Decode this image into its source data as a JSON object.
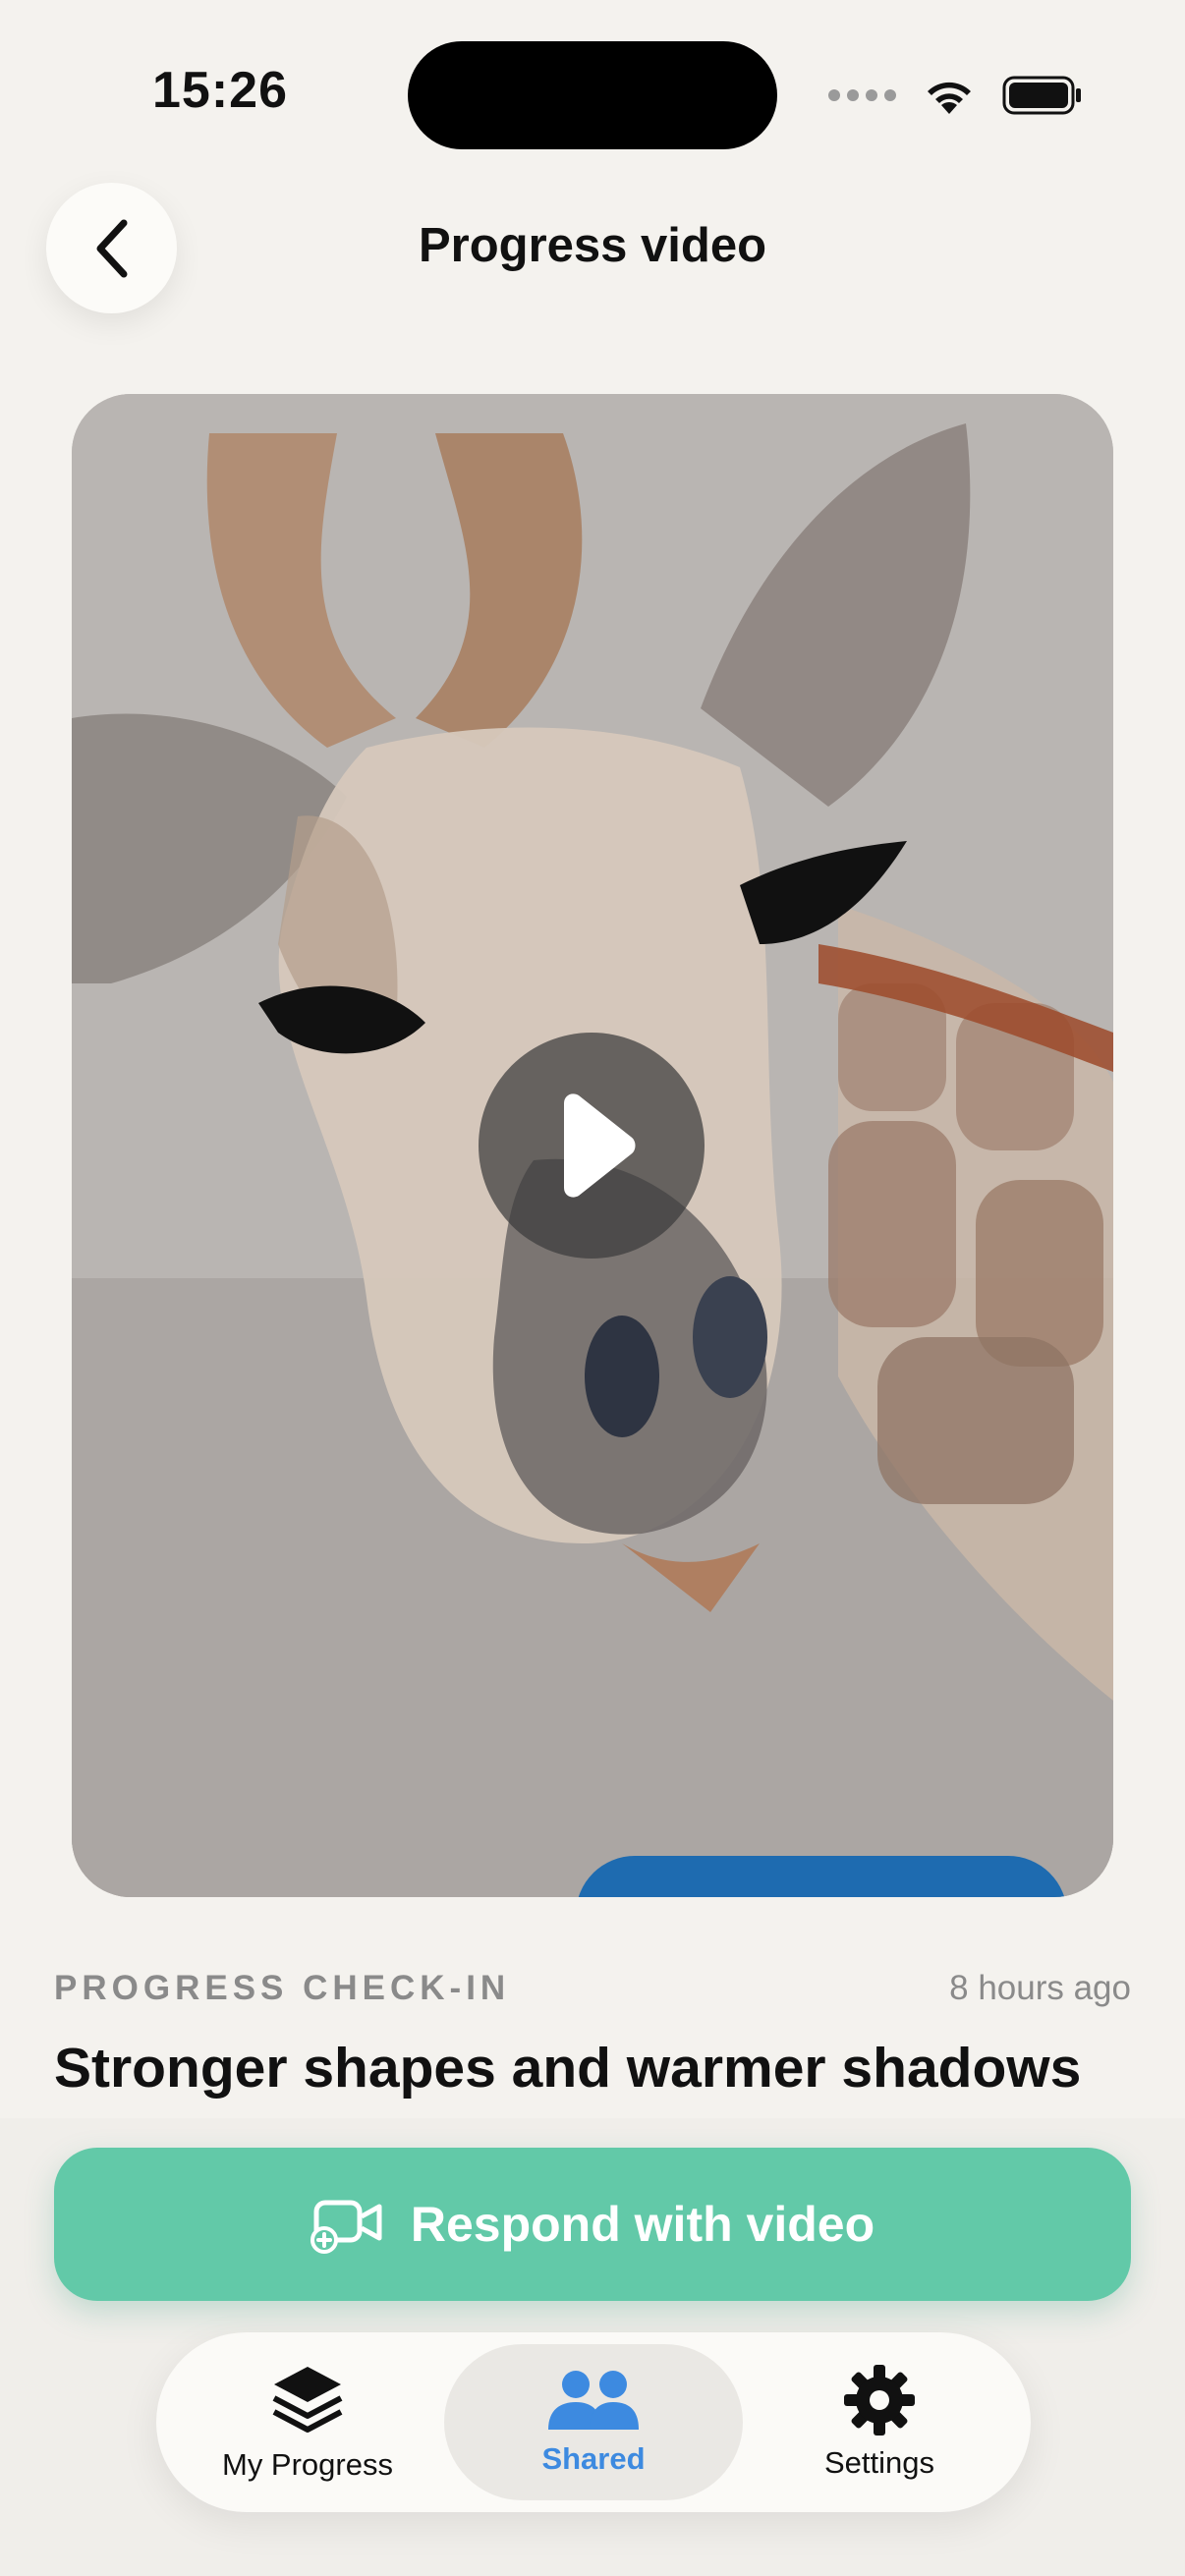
{
  "status_bar": {
    "time": "15:26"
  },
  "header": {
    "title": "Progress video"
  },
  "video": {
    "play_icon": "play-icon"
  },
  "post": {
    "kicker": "PROGRESS CHECK-IN",
    "time_ago": "8 hours ago",
    "title": "Stronger shapes and warmer shadows"
  },
  "actions": {
    "respond_label": "Respond with video"
  },
  "tabs": [
    {
      "label": "My Progress",
      "icon": "layers-icon",
      "selected": false
    },
    {
      "label": "Shared",
      "icon": "people-icon",
      "selected": true
    },
    {
      "label": "Settings",
      "icon": "gear-icon",
      "selected": false
    }
  ],
  "colors": {
    "accent": "#62C9A8",
    "tab_selected": "#3D8AE0",
    "background": "#F4F2EE"
  }
}
